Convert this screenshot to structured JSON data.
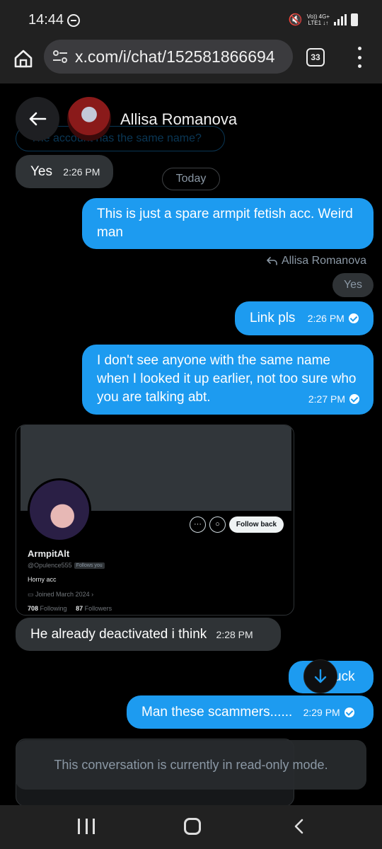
{
  "status_bar": {
    "time": "14:44",
    "network_top": "Vo)) 4G+",
    "network_bottom": "LTE1 ↓↑"
  },
  "browser": {
    "url": "x.com/i/chat/152581866694",
    "tab_count": "33"
  },
  "chat": {
    "contact_name": "Allisa Romanova",
    "faded_message": "The account has the same name?",
    "day_label": "Today",
    "read_only_notice": "This conversation is currently in read-only mode.",
    "messages": [
      {
        "text": "Yes",
        "time": "2:26 PM"
      },
      {
        "text": "This is just a spare armpit fetish acc. Weird man"
      },
      {
        "text": "Link pls",
        "time": "2:26 PM"
      },
      {
        "text": "I don't see anyone with the same name when I looked it up earlier, not too sure who you are talking abt.",
        "time": "2:27 PM"
      },
      {
        "text": "He already deactivated i think",
        "time": "2:28 PM"
      },
      {
        "text": "uck"
      },
      {
        "text": "Man these scammers......",
        "time": "2:29 PM"
      }
    ],
    "reply": {
      "to": "Allisa Romanova",
      "quote": "Yes"
    },
    "profile_card": {
      "display_name": "ArmpitAlt",
      "handle": "@Opulence555",
      "follows_you": "Follows you",
      "bio": "Horny acc",
      "joined": "Joined March 2024",
      "following_count": "708",
      "following_label": "Following",
      "followers_count": "87",
      "followers_label": "Followers",
      "follow_button": "Follow back"
    }
  },
  "colors": {
    "accent": "#1d9bf0",
    "incoming_bubble": "#2f3336",
    "background": "#000000"
  }
}
